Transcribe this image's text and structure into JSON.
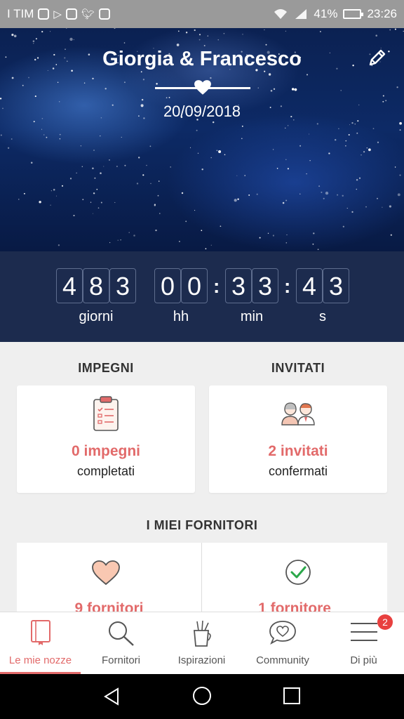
{
  "status_bar": {
    "carrier": "I TIM",
    "battery": "41%",
    "battery_level": 0.41,
    "time": "23:26",
    "icons": [
      "instagram-icon",
      "play-icon",
      "instagram-icon",
      "twitter-icon",
      "facebook-icon",
      "wifi-icon",
      "signal-icon",
      "battery-icon"
    ]
  },
  "hero": {
    "couple": "Giorgia & Francesco",
    "date": "20/09/2018",
    "edit_icon": "pencil-icon"
  },
  "countdown": {
    "days": [
      "4",
      "8",
      "3"
    ],
    "hours": [
      "0",
      "0"
    ],
    "minutes": [
      "3",
      "3"
    ],
    "seconds": [
      "4",
      "3"
    ],
    "labels": {
      "days": "giorni",
      "hours": "hh",
      "minutes": "min",
      "seconds": "s"
    }
  },
  "impegni": {
    "title": "IMPEGNI",
    "value": "0 impegni",
    "sub": "completati"
  },
  "invitati": {
    "title": "INVITATI",
    "value": "2 invitati",
    "sub": "confermati"
  },
  "fornitori": {
    "title": "I MIEI FORNITORI",
    "left_value": "9 fornitori",
    "right_value": "1 fornitore"
  },
  "nav": {
    "items": [
      {
        "label": "Le mie nozze",
        "icon": "notebook-icon",
        "active": true
      },
      {
        "label": "Fornitori",
        "icon": "search-icon"
      },
      {
        "label": "Ispirazioni",
        "icon": "brush-cup-icon"
      },
      {
        "label": "Community",
        "icon": "chat-heart-icon"
      },
      {
        "label": "Di più",
        "icon": "menu-icon"
      }
    ],
    "badge": "2"
  },
  "colors": {
    "accent": "#e26a6a",
    "navy": "#1c2b4e",
    "status_bar": "#9a9a9a"
  }
}
